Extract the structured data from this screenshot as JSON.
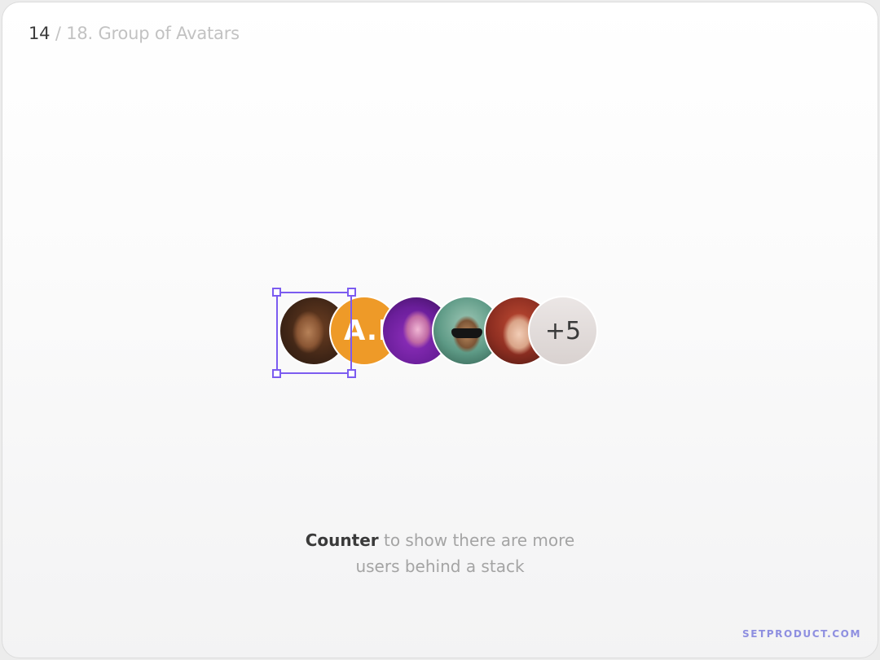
{
  "slide": {
    "current": "14",
    "separator": "/",
    "rest": "18. Group of Avatars"
  },
  "avatars": [
    {
      "type": "photo",
      "description": "man-portrait"
    },
    {
      "type": "initials",
      "text": "A.B",
      "color": "#ee9a28"
    },
    {
      "type": "photo",
      "description": "woman-purple-light"
    },
    {
      "type": "photo",
      "description": "man-sunglasses"
    },
    {
      "type": "photo",
      "description": "woman-red-hair"
    },
    {
      "type": "counter",
      "text": "+5"
    }
  ],
  "caption": {
    "emphasis": "Counter",
    "line1_rest": " to show there are more",
    "line2": "users behind a stack"
  },
  "footer": {
    "brand": "SETPRODUCT.COM"
  },
  "colors": {
    "selection": "#7c5cf0",
    "brand": "#8e8fe0",
    "initials_bg": "#ee9a28"
  }
}
